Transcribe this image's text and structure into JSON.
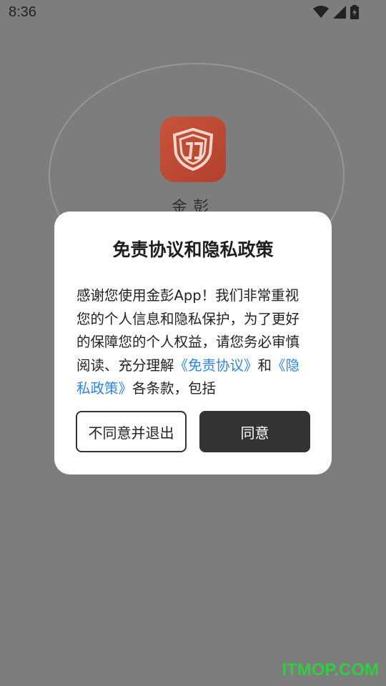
{
  "status_bar": {
    "time": "8:36",
    "icons": [
      "wifi-icon",
      "signal-icon",
      "battery-charging-icon"
    ]
  },
  "splash": {
    "app_name": "金彭",
    "brand_color": "#c8543a"
  },
  "dialog": {
    "title": "免责协议和隐私政策",
    "body_pre": "感谢您使用金彭App！我们非常重视您的个人信息和隐私保护，为了更好的保障您的个人权益，请您务必审慎阅读、充分理解",
    "link_disclaimer": "《免责协议》",
    "body_and": "和",
    "link_privacy": "《隐私政策》",
    "body_post": "各条款，包括",
    "decline_label": "不同意并退出",
    "agree_label": "同意",
    "link_color": "#2e86de"
  },
  "watermark": "ITMOP.COM"
}
